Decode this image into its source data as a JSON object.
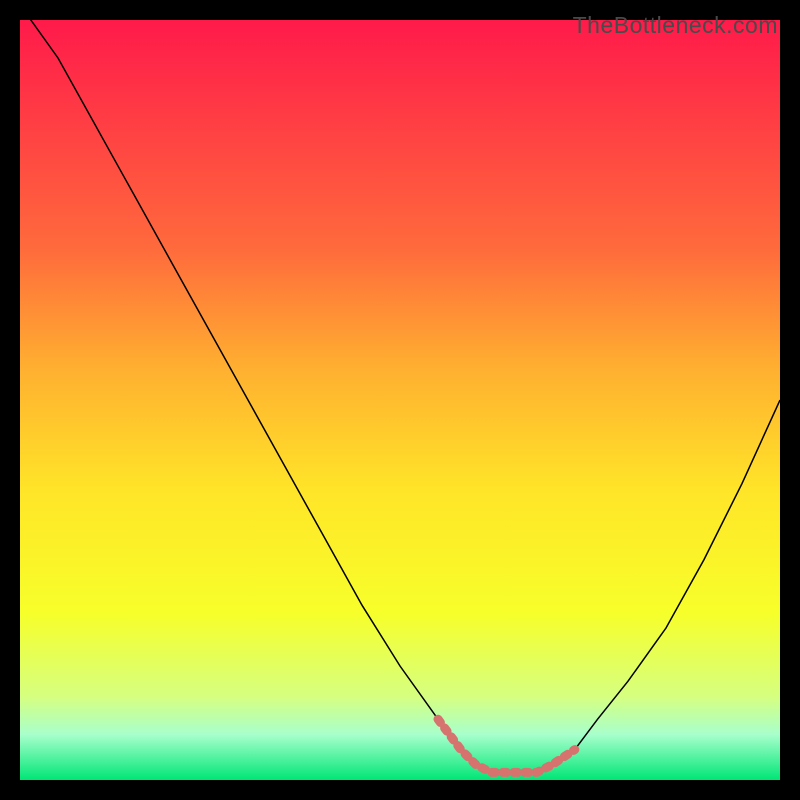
{
  "watermark": "TheBottleneck.com",
  "chart_data": {
    "type": "line",
    "title": "",
    "xlabel": "",
    "ylabel": "",
    "xlim": [
      0,
      100
    ],
    "ylim": [
      0,
      100
    ],
    "gradient_stops": [
      {
        "offset": 0,
        "color": "#ff1a4a"
      },
      {
        "offset": 30,
        "color": "#ff6a3c"
      },
      {
        "offset": 46,
        "color": "#ffb030"
      },
      {
        "offset": 62,
        "color": "#ffe528"
      },
      {
        "offset": 78,
        "color": "#f7ff2a"
      },
      {
        "offset": 89,
        "color": "#d6ff80"
      },
      {
        "offset": 94,
        "color": "#a8ffcc"
      },
      {
        "offset": 100,
        "color": "#00e676"
      }
    ],
    "series": [
      {
        "name": "curve",
        "x": [
          0,
          5,
          10,
          15,
          20,
          25,
          30,
          35,
          40,
          45,
          50,
          55,
          58,
          60,
          62,
          65,
          68,
          70,
          73,
          76,
          80,
          85,
          90,
          95,
          100
        ],
        "y": [
          102,
          95,
          86,
          77,
          68,
          59,
          50,
          41,
          32,
          23,
          15,
          8,
          4,
          2,
          1,
          1,
          1,
          2,
          4,
          8,
          13,
          20,
          29,
          39,
          50
        ]
      }
    ],
    "highlight_band": {
      "x_start": 55,
      "x_end": 73,
      "color": "#d6736f",
      "thickness": 9
    }
  }
}
